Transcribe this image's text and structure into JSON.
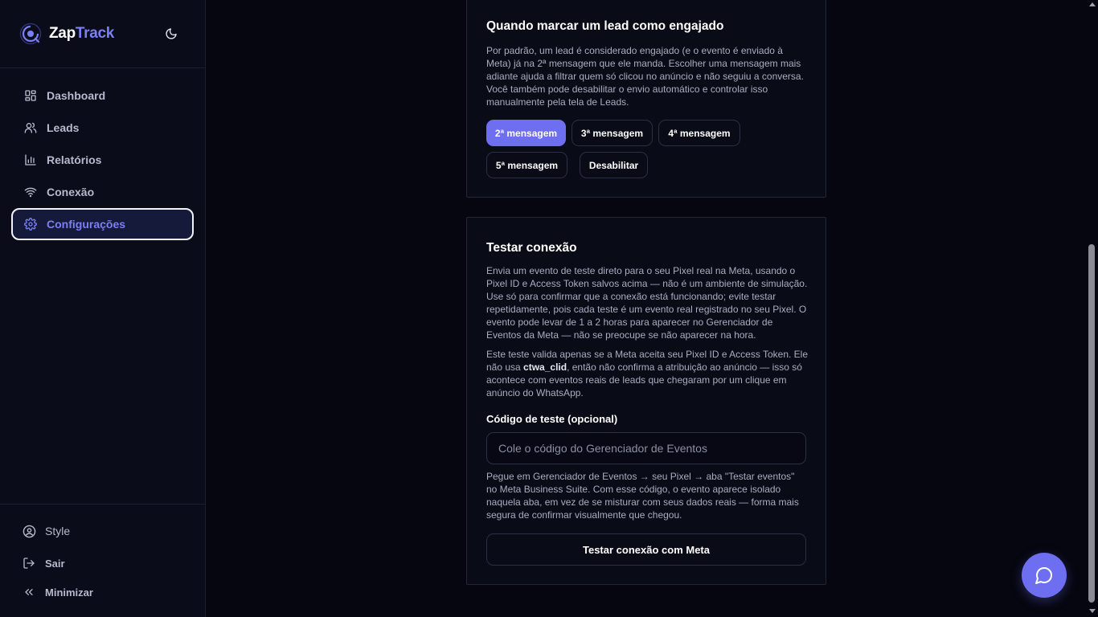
{
  "brand": {
    "name_part1": "Zap",
    "name_part2": "Track"
  },
  "sidebar": {
    "items": [
      {
        "label": "Dashboard",
        "icon": "grid-icon"
      },
      {
        "label": "Leads",
        "icon": "users-icon"
      },
      {
        "label": "Relatórios",
        "icon": "bar-chart-icon"
      },
      {
        "label": "Conexão",
        "icon": "wifi-icon"
      },
      {
        "label": "Configurações",
        "icon": "gear-icon",
        "active": true
      }
    ],
    "bottom": [
      {
        "label": "Style",
        "icon": "user-circle-icon"
      },
      {
        "label": "Sair",
        "icon": "logout-icon"
      },
      {
        "label": "Minimizar",
        "icon": "chevrons-left-icon"
      }
    ]
  },
  "engaged_card": {
    "title": "Quando marcar um lead como engajado",
    "description": "Por padrão, um lead é considerado engajado (e o evento é enviado à Meta) já na 2ª mensagem que ele manda. Escolher uma mensagem mais adiante ajuda a filtrar quem só clicou no anúncio e não seguiu a conversa. Você também pode desabilitar o envio automático e controlar isso manualmente pela tela de Leads.",
    "options": [
      "2ª mensagem",
      "3ª mensagem",
      "4ª mensagem",
      "5ª mensagem",
      "Desabilitar"
    ],
    "selected": "2ª mensagem"
  },
  "test_card": {
    "title": "Testar conexão",
    "paragraph1": "Envia um evento de teste direto para o seu Pixel real na Meta, usando o Pixel ID e Access Token salvos acima — não é um ambiente de simulação. Use só para confirmar que a conexão está funcionando; evite testar repetidamente, pois cada teste é um evento real registrado no seu Pixel. O evento pode levar de 1 a 2 horas para aparecer no Gerenciador de Eventos da Meta — não se preocupe se não aparecer na hora.",
    "paragraph2_before": "Este teste valida apenas se a Meta aceita seu Pixel ID e Access Token. Ele não usa ",
    "paragraph2_bold": "ctwa_clid",
    "paragraph2_after": ", então não confirma a atribuição ao anúncio — isso só acontece com eventos reais de leads que chegaram por um clique em anúncio do WhatsApp.",
    "field_label": "Código de teste (opcional)",
    "field_placeholder": "Cole o código do Gerenciador de Eventos",
    "field_value": "",
    "help": "Pegue em Gerenciador de Eventos → seu Pixel → aba \"Testar eventos\" no Meta Business Suite. Com esse código, o evento aparece isolado naquela aba, em vez de se misturar com seus dados reais — forma mais segura de confirmar visualmente que chegou.",
    "button_label": "Testar conexão com Meta"
  },
  "colors": {
    "accent": "#6e6ff0",
    "brand_accent": "#7b7ff5",
    "background": "#05060f",
    "card": "#090b17"
  }
}
